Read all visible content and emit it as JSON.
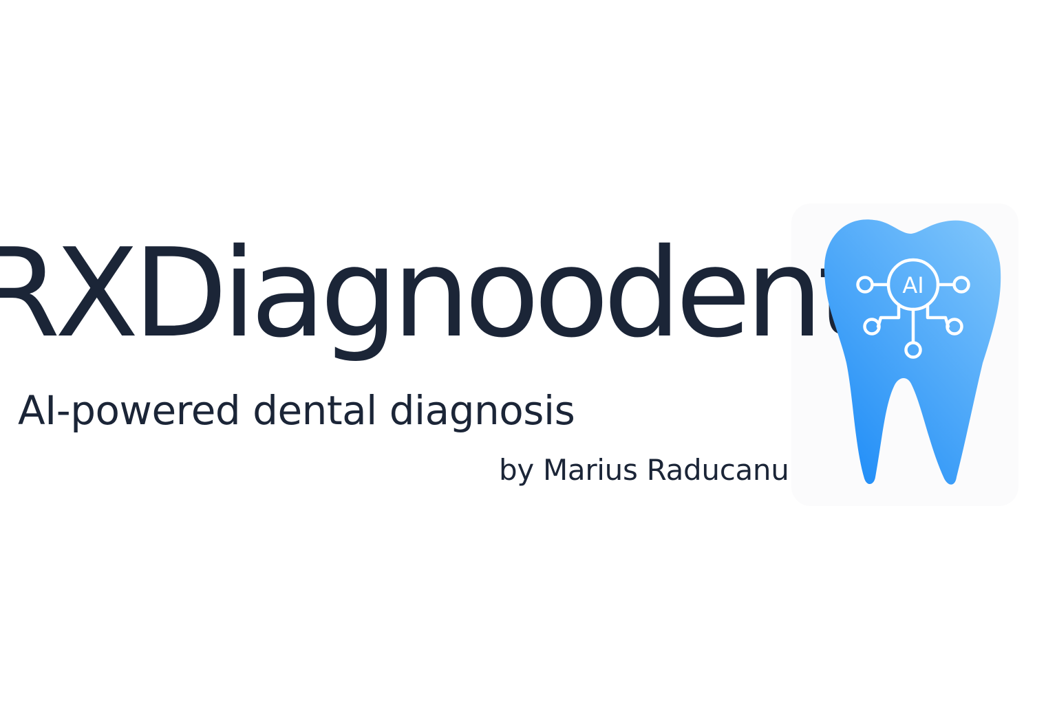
{
  "logo": {
    "brand_name": "RXDiagnoodent",
    "tagline": "AI-powered dental diagnosis",
    "author": "by Marius Raducanu",
    "icon": {
      "name": "tooth-ai-circuit-icon",
      "badge_text": "AI",
      "gradient_colors": [
        "#1e8cf7",
        "#7dc4fb"
      ]
    },
    "colors": {
      "text": "#1b2537",
      "background": "#ffffff"
    }
  }
}
